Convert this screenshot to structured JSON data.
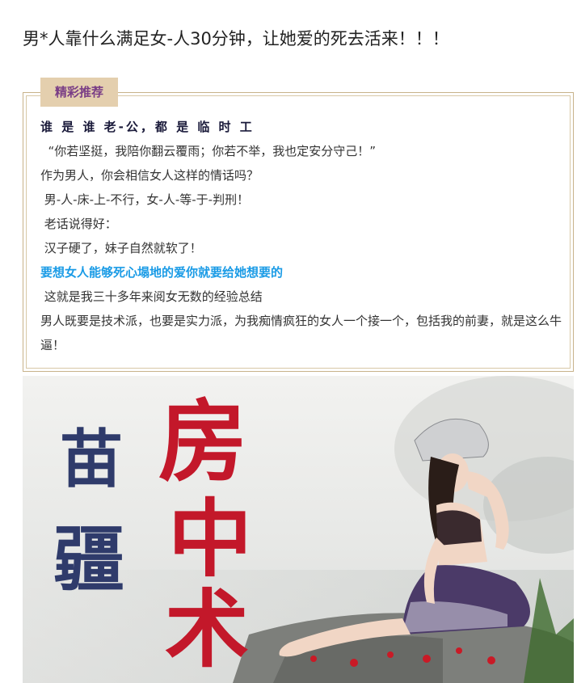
{
  "article": {
    "title": "男*人靠什么满足女-人30分钟，让她爱的死去活来！！！"
  },
  "recommend": {
    "tag": "精彩推荐",
    "lines": [
      "谁 是 谁 老-公，都 是 临 时 工",
      "  “你若坚挺，我陪你翻云覆雨；你若不举，我也定安分守己！”",
      "作为男人，你会相信女人这样的情话吗？",
      " 男-人-床-上-不行，女-人-等-于-判刑！",
      " 老话说得好：",
      " 汉子硬了，妹子自然就软了！",
      "要想女人能够死心塌地的爱你就要给她想要的",
      " 这就是我三十多年来阅女无数的经验总结",
      "男人既要是技术派，也要是实力派，为我痴情疯狂的女人一个接一个，包括我的前妻，就是这么牛逼！"
    ]
  },
  "hero": {
    "left_text": [
      "苗",
      "疆"
    ],
    "right_text": [
      "房",
      "中",
      "术"
    ],
    "colors": {
      "left_text": "#2f3b6b",
      "right_text": "#c3182a",
      "accent_blue": "#1a9be6",
      "tag_bg": "#e4cfae",
      "tag_text": "#7a3e86"
    }
  }
}
